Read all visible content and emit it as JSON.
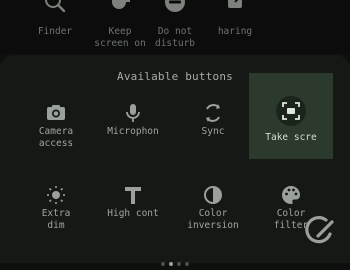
{
  "quick_settings": [
    {
      "label": "Finder",
      "icon": "search-icon"
    },
    {
      "label": "Keep\nscreen on",
      "icon": "coffee-icon"
    },
    {
      "label": "Do not\ndisturb",
      "icon": "do-not-disturb-icon"
    },
    {
      "label": "haring",
      "icon": "share-icon"
    }
  ],
  "panel": {
    "heading": "Available buttons",
    "buttons": [
      {
        "label": "Camera\naccess",
        "icon": "camera-icon",
        "active": false
      },
      {
        "label": "Microphon",
        "icon": "microphone-icon",
        "active": false
      },
      {
        "label": "Sync",
        "icon": "sync-icon",
        "active": false
      },
      {
        "label": "Take scre",
        "icon": "screenshot-icon",
        "active": true
      },
      {
        "label": "Extra\ndim",
        "icon": "extra-dim-icon",
        "active": false
      },
      {
        "label": "High cont",
        "icon": "high-contrast-text-icon",
        "active": false
      },
      {
        "label": "Color\ninversion",
        "icon": "color-inversion-icon",
        "active": false
      },
      {
        "label": "Color\nfilter",
        "icon": "palette-icon",
        "active": false
      }
    ]
  },
  "pagination": {
    "pages": 4,
    "current": 2
  },
  "colors": {
    "accent_tile": "#2b3a2d",
    "panel": "#161816",
    "text": "#a0a5a0"
  }
}
